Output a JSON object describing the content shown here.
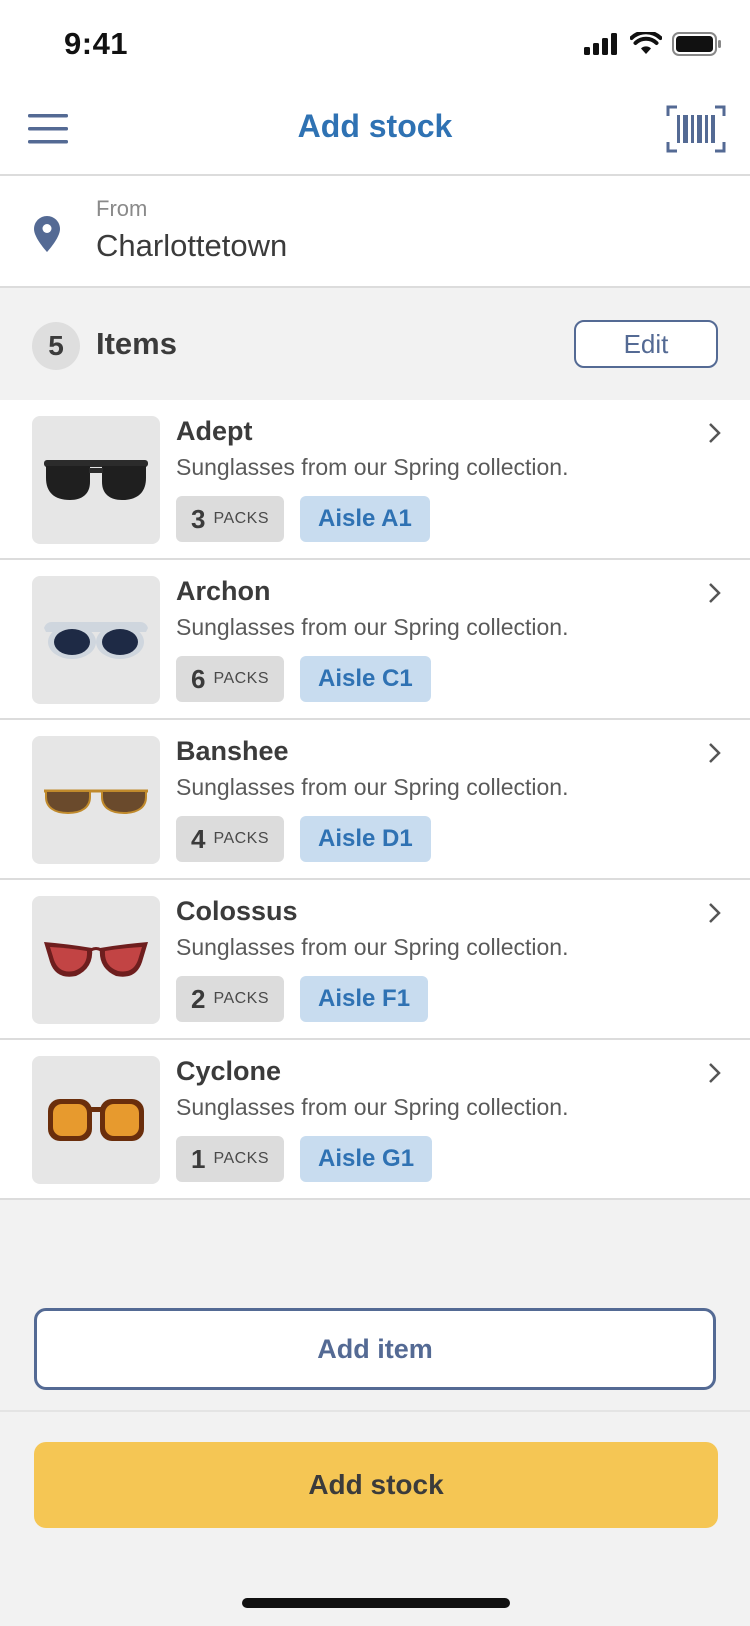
{
  "status_bar": {
    "time": "9:41"
  },
  "header": {
    "title": "Add stock"
  },
  "from": {
    "label": "From",
    "location": "Charlottetown"
  },
  "items_header": {
    "count": "5",
    "label": "Items",
    "edit_label": "Edit"
  },
  "items": [
    {
      "name": "Adept",
      "description": "Sunglasses from our Spring collection.",
      "packs": "3",
      "unit": "PACKS",
      "aisle": "Aisle A1",
      "frame_color": "#2b2b2b",
      "lens_color": "#1f1f1f",
      "icon": "sunglasses-black-icon"
    },
    {
      "name": "Archon",
      "description": "Sunglasses from our Spring collection.",
      "packs": "6",
      "unit": "PACKS",
      "aisle": "Aisle C1",
      "frame_color": "#cfd6de",
      "lens_color": "#1e2a45",
      "icon": "sunglasses-clear-icon"
    },
    {
      "name": "Banshee",
      "description": "Sunglasses from our Spring collection.",
      "packs": "4",
      "unit": "PACKS",
      "aisle": "Aisle D1",
      "frame_color": "#c08a2c",
      "lens_color": "#6a4a2c",
      "icon": "sunglasses-gold-icon"
    },
    {
      "name": "Colossus",
      "description": "Sunglasses from our Spring collection.",
      "packs": "2",
      "unit": "PACKS",
      "aisle": "Aisle F1",
      "frame_color": "#6e1e1e",
      "lens_color": "#c24444",
      "icon": "sunglasses-cateye-icon"
    },
    {
      "name": "Cyclone",
      "description": "Sunglasses from our Spring collection.",
      "packs": "1",
      "unit": "PACKS",
      "aisle": "Aisle G1",
      "frame_color": "#6a2e0c",
      "lens_color": "#e79a2e",
      "icon": "sunglasses-tortoise-icon"
    }
  ],
  "actions": {
    "add_item_label": "Add item",
    "add_stock_label": "Add stock"
  },
  "colors": {
    "accent": "#2f72b3",
    "primary_button": "#f5c654",
    "outline": "#546a94"
  }
}
